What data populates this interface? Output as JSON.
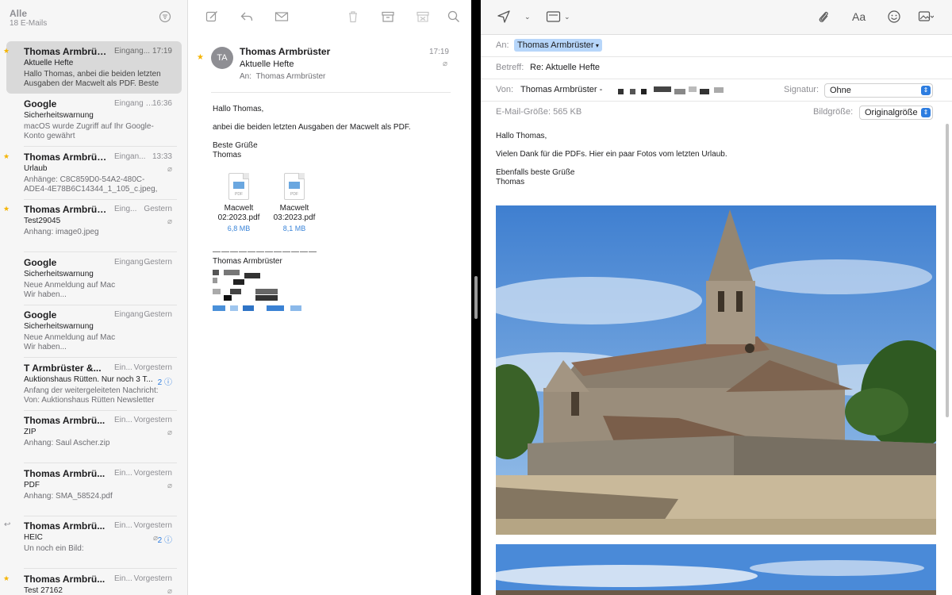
{
  "mailbox": {
    "title": "Alle",
    "count": "18 E-Mails"
  },
  "messages": [
    {
      "sender": "Thomas Armbrüster",
      "mailbox": "Eingang...",
      "time": "17:19",
      "subject": "Aktuelle Hefte",
      "preview": "Hallo Thomas, anbei die beiden letzten\nAusgaben der Macwelt als PDF. Beste Gr...",
      "starred": true,
      "selected": true
    },
    {
      "sender": "Google",
      "mailbox": "Eingang - Google",
      "time": "16:36",
      "subject": "Sicherheitswarnung",
      "preview": "macOS wurde Zugriff auf Ihr Google-\nKonto gewährt"
    },
    {
      "sender": "Thomas Armbrüster",
      "mailbox": "Eingan...",
      "time": "13:33",
      "subject": "Urlaub",
      "preview": "Anhänge: C8C859D0-54A2-480C-\nADE4-4E78B6C14344_1_105_c.jpeg, 51...",
      "starred": true,
      "attachment": true
    },
    {
      "sender": "Thomas Armbrüster",
      "mailbox": "Eing...",
      "time": "Gestern",
      "subject": "Test29045",
      "preview": "Anhang: image0.jpeg",
      "starred": true,
      "attachment": true
    },
    {
      "sender": "Google",
      "mailbox": "Eingang - Google",
      "time": "Gestern",
      "subject": "Sicherheitswarnung",
      "preview": "Neue Anmeldung auf Mac\nWir haben..."
    },
    {
      "sender": "Google",
      "mailbox": "Eingang - Google",
      "time": "Gestern",
      "subject": "Sicherheitswarnung",
      "preview": "Neue Anmeldung auf Mac\nWir haben..."
    },
    {
      "sender": "T Armbrüster &...",
      "mailbox": "Ein...",
      "time": "Vorgestern",
      "subject": "Auktionshaus Rütten. Nur noch 3 T...",
      "preview": "Anfang der weitergeleiteten Nachricht:\nVon: Auktionshaus Rütten Newsletter <n...",
      "thread": "2"
    },
    {
      "sender": "Thomas Armbrü...",
      "mailbox": "Ein...",
      "time": "Vorgestern",
      "subject": "ZIP",
      "preview": "Anhang: Saul Ascher.zip",
      "attachment": true
    },
    {
      "sender": "Thomas Armbrü...",
      "mailbox": "Ein...",
      "time": "Vorgestern",
      "subject": "PDF",
      "preview": "Anhang: SMA_58524.pdf",
      "attachment": true
    },
    {
      "sender": "Thomas Armbrü...",
      "mailbox": "Ein...",
      "time": "Vorgestern",
      "subject": "HEIC",
      "preview": "Un noch ein Bild:",
      "replied": true,
      "attachment": true,
      "thread": "2"
    },
    {
      "sender": "Thomas Armbrü...",
      "mailbox": "Ein...",
      "time": "Vorgestern",
      "subject": "Test 27162",
      "preview": "",
      "starred": true,
      "attachment": true
    }
  ],
  "reader": {
    "initials": "TA",
    "sender": "Thomas Armbrüster",
    "subject": "Aktuelle Hefte",
    "to_label": "An:",
    "to": "Thomas Armbrüster",
    "time": "17:19",
    "greeting": "Hallo Thomas,",
    "body": "anbei die beiden letzten Ausgaben der Macwelt als PDF.",
    "closing": "Beste Grüße",
    "closing_name": "Thomas",
    "attachments": [
      {
        "name": "Macwelt 02:2023.pdf",
        "size": "6,8 MB"
      },
      {
        "name": "Macwelt 03:2023.pdf",
        "size": "8,1 MB"
      }
    ],
    "signature_line": "————————————",
    "signature_name": "Thomas Armbrüster"
  },
  "compose": {
    "to_label": "An:",
    "to": "Thomas Armbrüster",
    "subject_label": "Betreff:",
    "subject": "Re: Aktuelle Hefte",
    "from_label": "Von:",
    "from": "Thomas Armbrüster -",
    "signature_label": "Signatur:",
    "signature_value": "Ohne",
    "size_label": "E-Mail-Größe:",
    "size_value": "565 KB",
    "image_size_label": "Bildgröße:",
    "image_size_value": "Originalgröße",
    "greeting": "Hallo Thomas,",
    "body": "Vielen Dank für die PDFs. Hier ein paar Fotos vom letzten Urlaub.",
    "closing": "Ebenfalls beste Grüße",
    "closing_name": "Thomas",
    "format_label": "Aa"
  },
  "colors": {
    "accent": "#2d7de0",
    "star": "#f5b400",
    "selection": "#d9d9d9",
    "token": "#b7d6fa"
  }
}
